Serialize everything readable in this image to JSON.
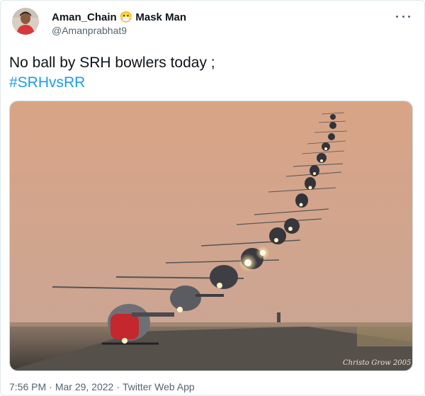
{
  "tweet": {
    "author_name": "Aman_Chain",
    "author_badge_emoji": "😷",
    "author_name_suffix": "Mask Man",
    "handle": "@Amanprabhat9",
    "text_line1": "No ball by SRH bowlers today ;",
    "hashtag": "#SRHvsRR",
    "media": {
      "icon": "helicopter-formation-photo",
      "watermark": "Christo Grow 2005"
    },
    "time": "7:56 PM",
    "separator": "·",
    "date": "Mar 29, 2022",
    "source": "Twitter Web App"
  },
  "colors": {
    "link": "#1d9bf0",
    "secondary_text": "#536471",
    "sky_top": "#d9a486",
    "sky_bottom": "#caa393"
  }
}
